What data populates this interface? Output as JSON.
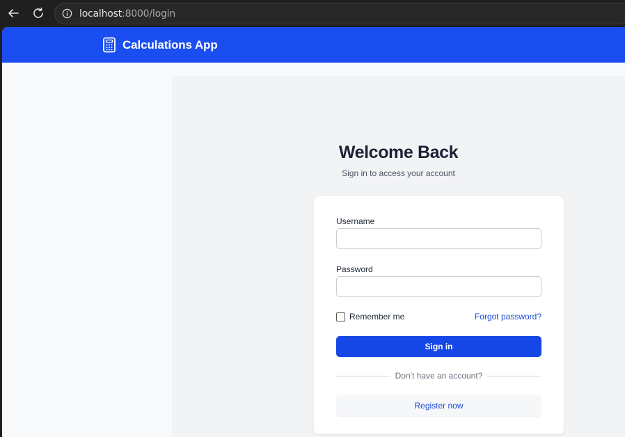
{
  "browser": {
    "url_host": "localhost",
    "url_rest": ":8000/login"
  },
  "header": {
    "app_name": "Calculations App",
    "brand_color": "#1a4ef0"
  },
  "login": {
    "title": "Welcome Back",
    "subtitle": "Sign in to access your account",
    "username_label": "Username",
    "username_value": "",
    "password_label": "Password",
    "password_value": "",
    "remember_label": "Remember me",
    "remember_checked": false,
    "forgot_label": "Forgot password?",
    "signin_label": "Sign in",
    "divider_text": "Don't have an account?",
    "register_label": "Register now",
    "accent_color": "#1447e6"
  },
  "icons": {
    "back": "arrow-left-icon",
    "reload": "reload-icon",
    "info": "info-icon",
    "brand": "calculator-icon"
  }
}
